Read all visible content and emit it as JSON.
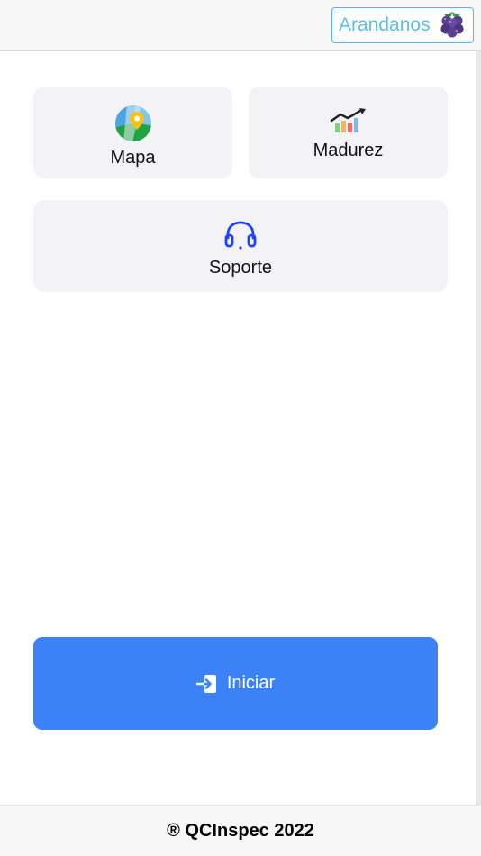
{
  "header": {
    "crop_label": "Arandanos",
    "crop_icon": "blueberry-icon"
  },
  "menu": {
    "mapa": {
      "label": "Mapa",
      "icon": "map-pin-icon"
    },
    "madurez": {
      "label": "Madurez",
      "icon": "chart-trend-icon"
    },
    "soporte": {
      "label": "Soporte",
      "icon": "headset-icon"
    }
  },
  "start": {
    "label": "Iniciar",
    "icon": "sign-in-icon"
  },
  "footer": {
    "text": "® QCInspec 2022"
  },
  "colors": {
    "primary": "#3b82f6",
    "accent": "#4fb9e3",
    "card_bg": "#f3f3f6",
    "support_icon": "#1e40ff"
  }
}
